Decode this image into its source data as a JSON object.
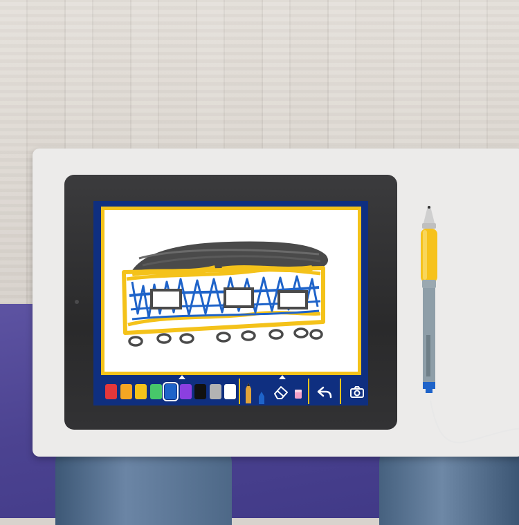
{
  "app": {
    "name": "",
    "colors": {
      "screen_background": "#0f2f80",
      "frame_accent": "#f4c21a",
      "canvas": "#ffffff"
    }
  },
  "palette": {
    "selected_index": 4,
    "colors": [
      {
        "name": "red",
        "hex": "#e5373a"
      },
      {
        "name": "orange",
        "hex": "#f5a623"
      },
      {
        "name": "yellow",
        "hex": "#f4c21a"
      },
      {
        "name": "green",
        "hex": "#47c76a"
      },
      {
        "name": "blue",
        "hex": "#1e63c9"
      },
      {
        "name": "purple",
        "hex": "#8b3fe0"
      },
      {
        "name": "black",
        "hex": "#111111"
      },
      {
        "name": "gray",
        "hex": "#b3b3b3"
      },
      {
        "name": "white",
        "hex": "#ffffff"
      }
    ]
  },
  "tools": [
    {
      "name": "pencil-icon",
      "selected": false
    },
    {
      "name": "marker-icon",
      "selected": false
    },
    {
      "name": "eraser-icon",
      "selected": true
    },
    {
      "name": "pink-eraser-icon",
      "selected": false
    }
  ],
  "actions": [
    {
      "name": "undo-icon"
    },
    {
      "name": "camera-icon"
    }
  ],
  "drawing": {
    "subject": "train car",
    "stroke_colors": [
      "#4a4a4a",
      "#f4c21a",
      "#1e63c9"
    ]
  }
}
